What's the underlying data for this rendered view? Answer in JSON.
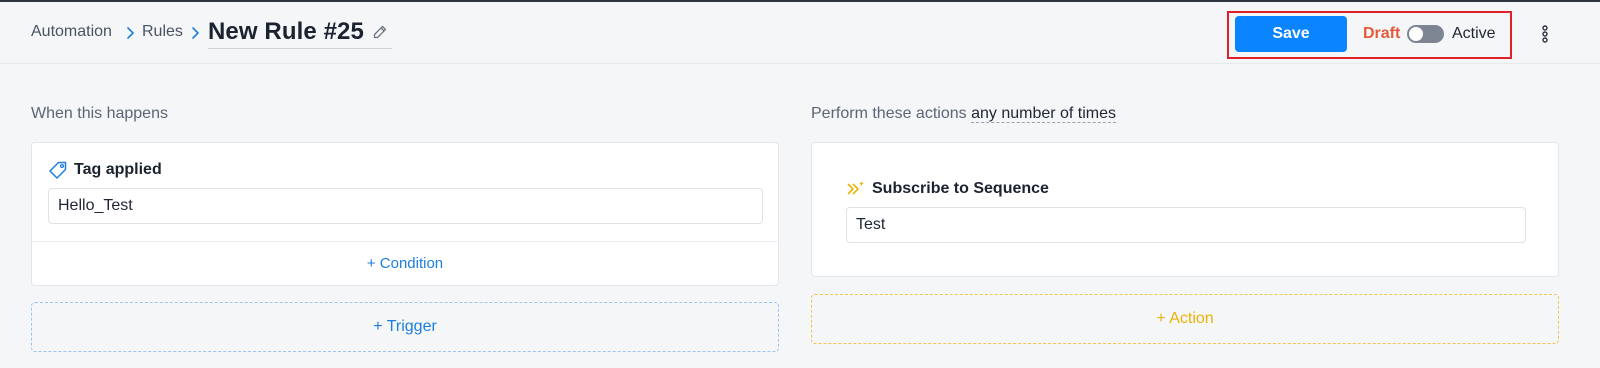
{
  "breadcrumb": {
    "items": [
      "Automation",
      "Rules"
    ],
    "title": "New Rule #25"
  },
  "toolbar": {
    "save_label": "Save",
    "status_off_label": "Draft",
    "status_on_label": "Active",
    "status_active": false
  },
  "trigger_section": {
    "label": "When this happens",
    "card": {
      "title": "Tag applied",
      "icon": "tag-icon",
      "value": "Hello_Test",
      "add_condition_label": "+ Condition"
    },
    "add_trigger_label": "+ Trigger"
  },
  "action_section": {
    "label_prefix": "Perform these actions",
    "label_emphasis": "any number of times",
    "card": {
      "title": "Subscribe to Sequence",
      "icon": "sequence-icon",
      "value": "Test"
    },
    "add_action_label": "+ Action"
  },
  "colors": {
    "accent": "#0a84ff",
    "draft": "#e55a3c",
    "trigger_accent": "#1c7fe0",
    "action_accent": "#eab308",
    "highlight_box": "#e0202a"
  }
}
